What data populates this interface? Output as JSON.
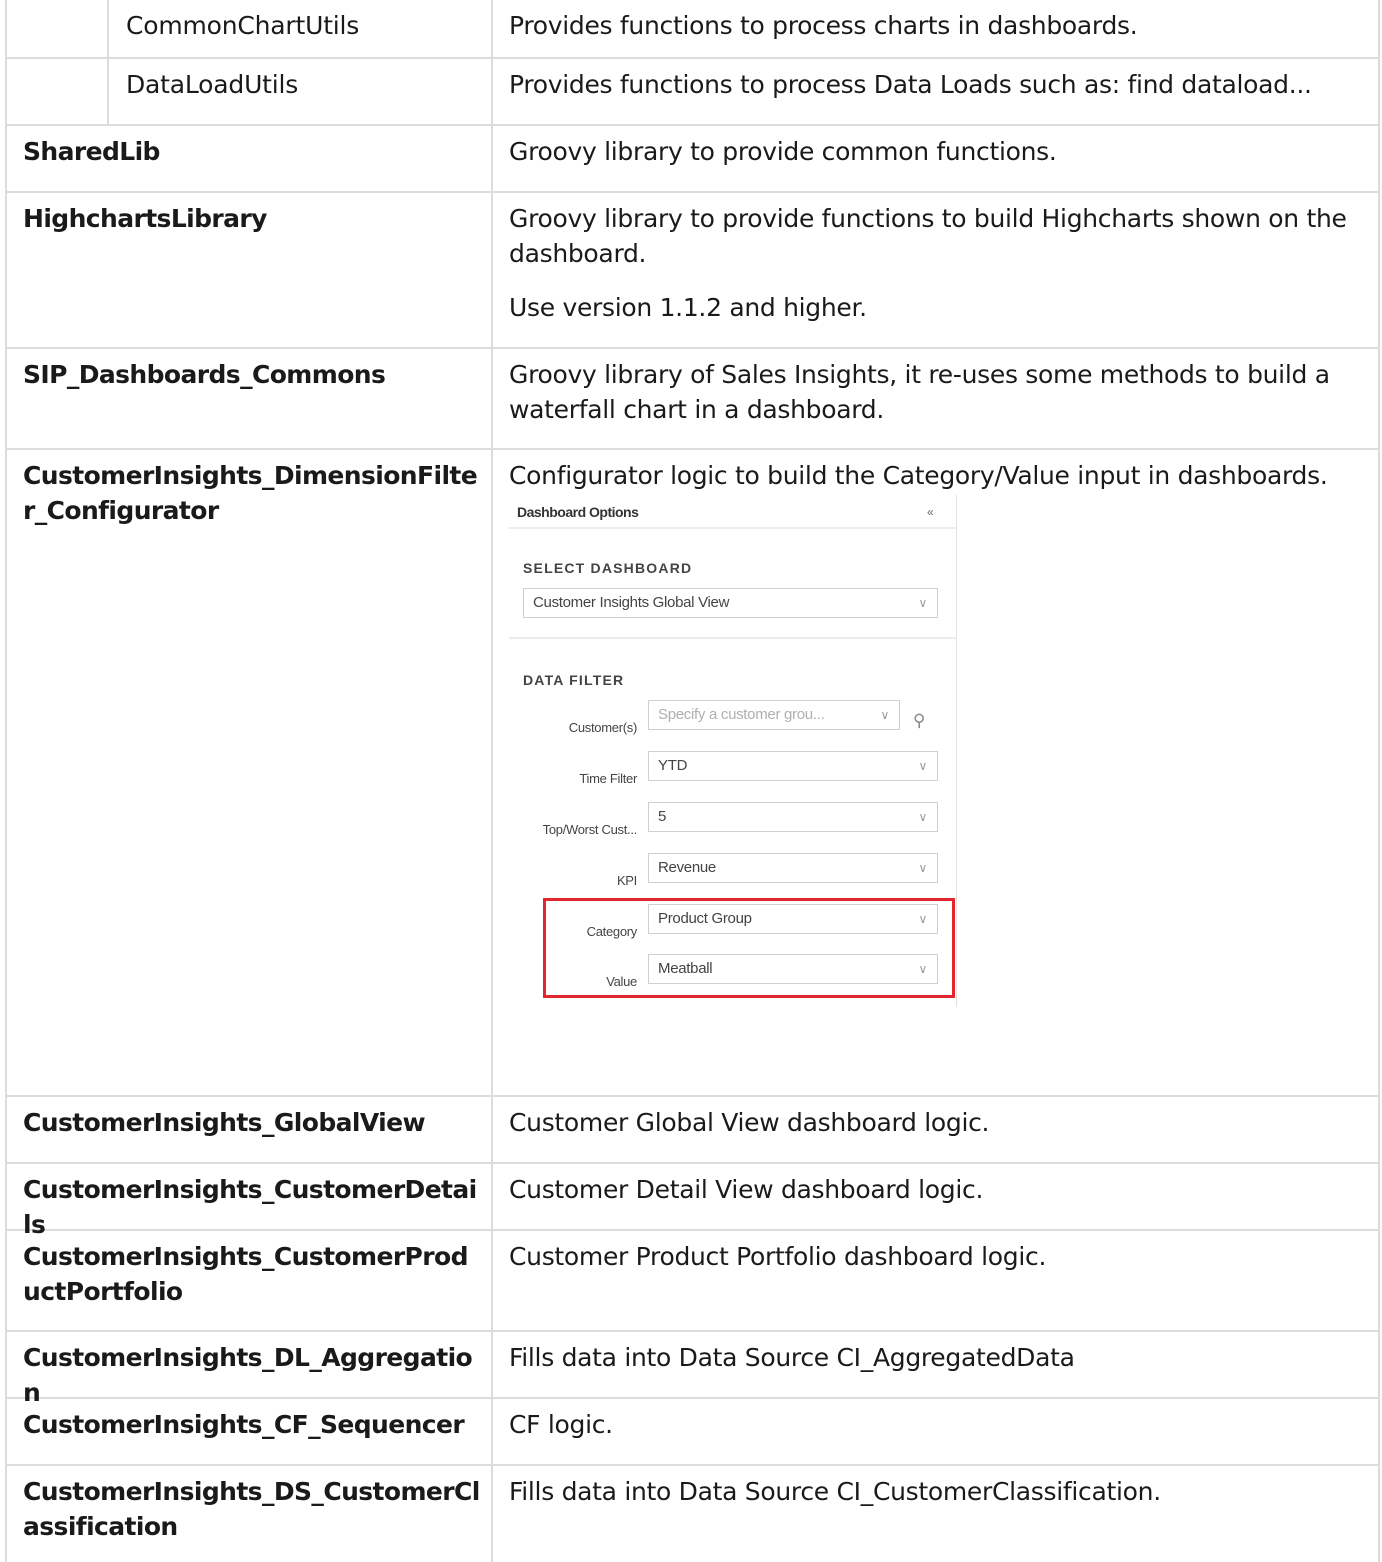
{
  "rows": [
    {
      "name": "CommonChartUtils",
      "desc": "Provides functions to process charts in dashboards."
    },
    {
      "name": "DataLoadUtils",
      "desc": "Provides functions to process Data Loads such as: find dataload..."
    },
    {
      "name": "SharedLib",
      "desc": "Groovy library to provide common functions."
    },
    {
      "name": "HighchartsLibrary",
      "desc": "Groovy library to provide functions to build Highcharts shown on the dashboard.",
      "desc2": "Use version 1.1.2 and higher."
    },
    {
      "name": "SIP_Dashboards_Commons",
      "desc": "Groovy library of Sales Insights, it re-uses some methods to build a waterfall chart in a dashboard."
    },
    {
      "name": "CustomerInsights_DimensionFilter_Configurator",
      "desc": "Configurator logic to build the Category/Value input in dashboards."
    },
    {
      "name": "CustomerInsights_GlobalView",
      "desc": "Customer Global View dashboard logic."
    },
    {
      "name": "CustomerInsights_CustomerDetails",
      "desc": "Customer Detail View dashboard logic."
    },
    {
      "name": "CustomerInsights_CustomerProductPortfolio",
      "desc": "Customer Product Portfolio dashboard logic."
    },
    {
      "name": "CustomerInsights_DL_Aggregation",
      "desc": "Fills data into Data Source CI_AggregatedData"
    },
    {
      "name": "CustomerInsights_CF_Sequencer",
      "desc": "CF logic."
    },
    {
      "name": "CustomerInsights_DS_CustomerClassification",
      "desc": "Fills data into Data Source CI_CustomerClassification."
    }
  ],
  "panel": {
    "title": "Dashboard Options",
    "collapse_icon": "«",
    "select_dashboard_label": "SELECT DASHBOARD",
    "dashboard_value": "Customer Insights Global View",
    "data_filter_label": "DATA FILTER",
    "chevron": "∨",
    "search_icon": "⚲",
    "filters": {
      "customers": {
        "label": "Customer(s)",
        "placeholder": "Specify a customer grou..."
      },
      "time": {
        "label": "Time Filter",
        "value": "YTD"
      },
      "top": {
        "label": "Top/Worst Cust...",
        "value": "5"
      },
      "kpi": {
        "label": "KPI",
        "value": "Revenue"
      },
      "category": {
        "label": "Category",
        "value": "Product Group"
      },
      "value": {
        "label": "Value",
        "value": "Meatball"
      }
    },
    "highlight_color": "#e3262b"
  }
}
